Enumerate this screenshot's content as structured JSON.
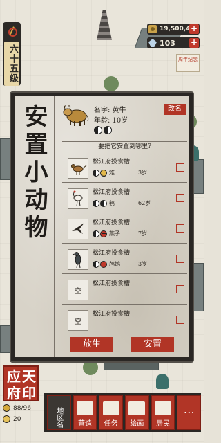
{
  "hud": {
    "level": "六十五级",
    "money": "19,500,464",
    "jade": "103",
    "plus": "+",
    "seal_badge": "周年纪念"
  },
  "panel": {
    "title": "安置小动物",
    "animal": {
      "name": "名字: 黄牛",
      "age": "年龄: 10岁",
      "rename": "改名"
    },
    "prompt": "要把它安置到哪里?",
    "rows": [
      {
        "title": "松江府投食槽",
        "pet": "雉",
        "age": "3岁",
        "has_pet": true,
        "icon": "pheasant-icon"
      },
      {
        "title": "松江府投食槽",
        "pet": "鹤",
        "age": "62岁",
        "has_pet": true,
        "icon": "crane-icon"
      },
      {
        "title": "松江府投食槽",
        "pet": "燕子",
        "age": "7岁",
        "has_pet": true,
        "icon": "swallow-icon"
      },
      {
        "title": "松江府投食槽",
        "pet": "鸬鹚",
        "age": "3岁",
        "has_pet": true,
        "icon": "cormorant-icon"
      },
      {
        "title": "松江府投食槽",
        "pet": "",
        "age": "",
        "has_pet": false,
        "thumb": "空"
      },
      {
        "title": "松江府投食槽",
        "pet": "",
        "age": "",
        "has_pet": false,
        "thumb": "空"
      }
    ],
    "release": "放生",
    "place": "安置"
  },
  "bottom": {
    "seal_chars": [
      "应",
      "天",
      "府",
      "印"
    ],
    "pop": "88/96",
    "happy": "20",
    "map_label": "地区名",
    "tools": [
      "营造",
      "任务",
      "绘画",
      "居民"
    ],
    "more": "⋯"
  }
}
